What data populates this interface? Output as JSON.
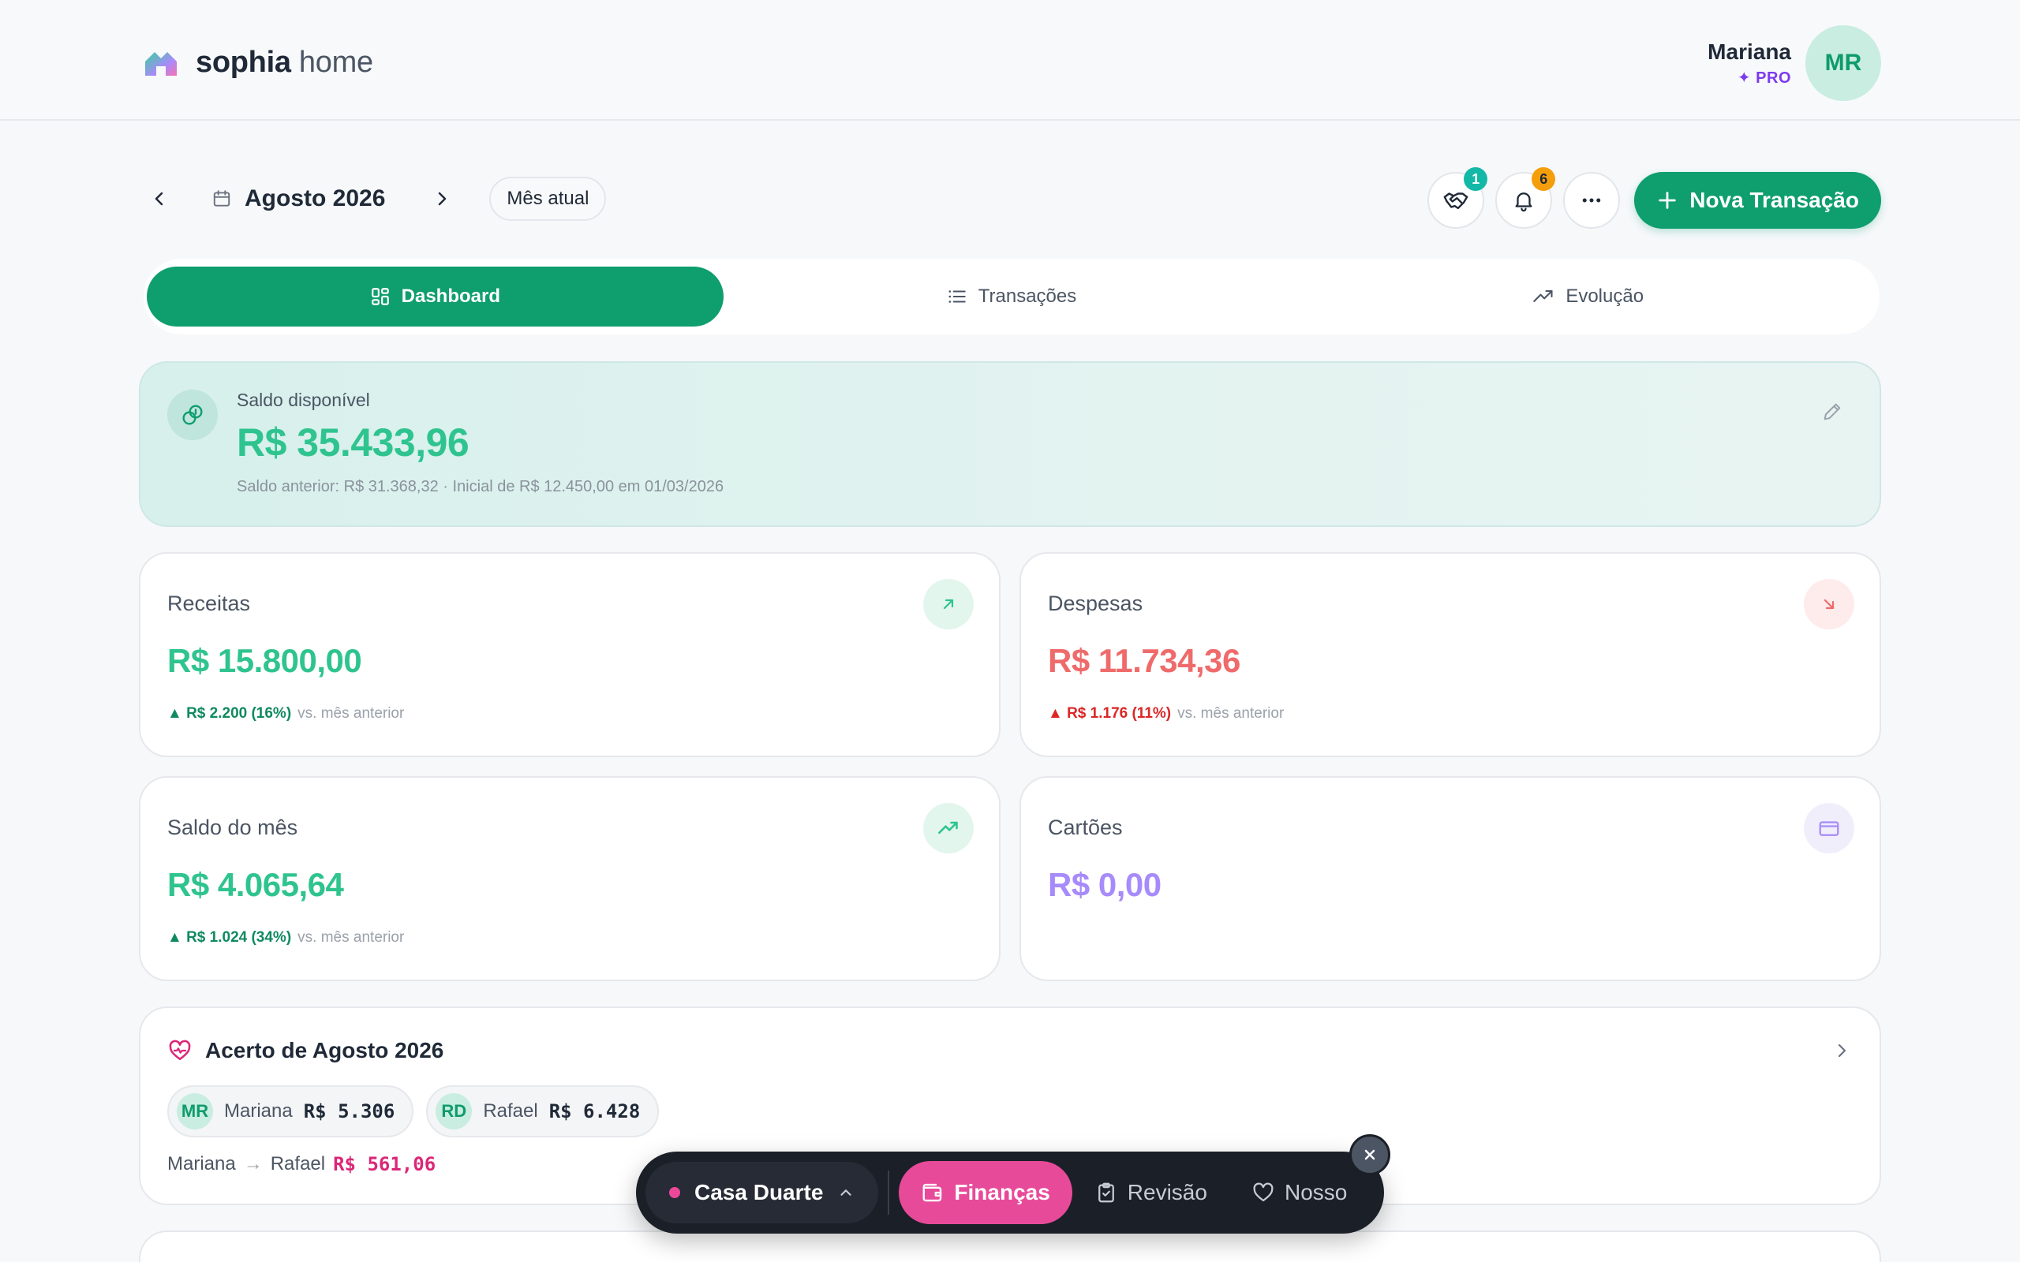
{
  "app": {
    "brand_bold": "sophia",
    "brand_light": " home"
  },
  "user": {
    "name": "Mariana",
    "plan": "✦ PRO",
    "initials": "MR"
  },
  "period": {
    "label": "Agosto 2026",
    "current_month_button": "Mês atual"
  },
  "actions": {
    "handshake_badge": "1",
    "bell_badge": "6",
    "new_transaction": "Nova Transação"
  },
  "tabs": [
    {
      "label": "Dashboard",
      "active": true
    },
    {
      "label": "Transações",
      "active": false
    },
    {
      "label": "Evolução",
      "active": false
    }
  ],
  "balance": {
    "label": "Saldo disponível",
    "value": "R$ 35.433,96",
    "subtitle": "Saldo anterior: R$ 31.368,32 · Inicial de R$ 12.450,00 em 01/03/2026"
  },
  "cards": {
    "income": {
      "title": "Receitas",
      "value": "R$ 15.800,00",
      "delta": "▲ R$ 2.200 (16%)",
      "vs": "vs. mês anterior",
      "color": "#2fc48f"
    },
    "expenses": {
      "title": "Despesas",
      "value": "R$ 11.734,36",
      "delta": "▲ R$ 1.176 (11%)",
      "vs": "vs. mês anterior",
      "color": "#ef6b6b"
    },
    "month_balance": {
      "title": "Saldo do mês",
      "value": "R$ 4.065,64",
      "delta": "▲ R$ 1.024 (34%)",
      "vs": "vs. mês anterior",
      "color": "#2fc48f"
    },
    "cards": {
      "title": "Cartões",
      "value": "R$ 0,00",
      "color": "#a78bfa"
    }
  },
  "settlement": {
    "title": "Acerto de Agosto 2026",
    "people": [
      {
        "initials": "MR",
        "name": "Mariana",
        "amount": "R$ 5.306"
      },
      {
        "initials": "RD",
        "name": "Rafael",
        "amount": "R$ 6.428"
      }
    ],
    "from": "Mariana",
    "arrow": "→",
    "to": "Rafael",
    "amount": "R$ 561,06"
  },
  "dock": {
    "household": "Casa Duarte",
    "items": [
      {
        "label": "Finanças",
        "active": true
      },
      {
        "label": "Revisão",
        "active": false
      },
      {
        "label": "Nosso",
        "active": false
      }
    ]
  }
}
